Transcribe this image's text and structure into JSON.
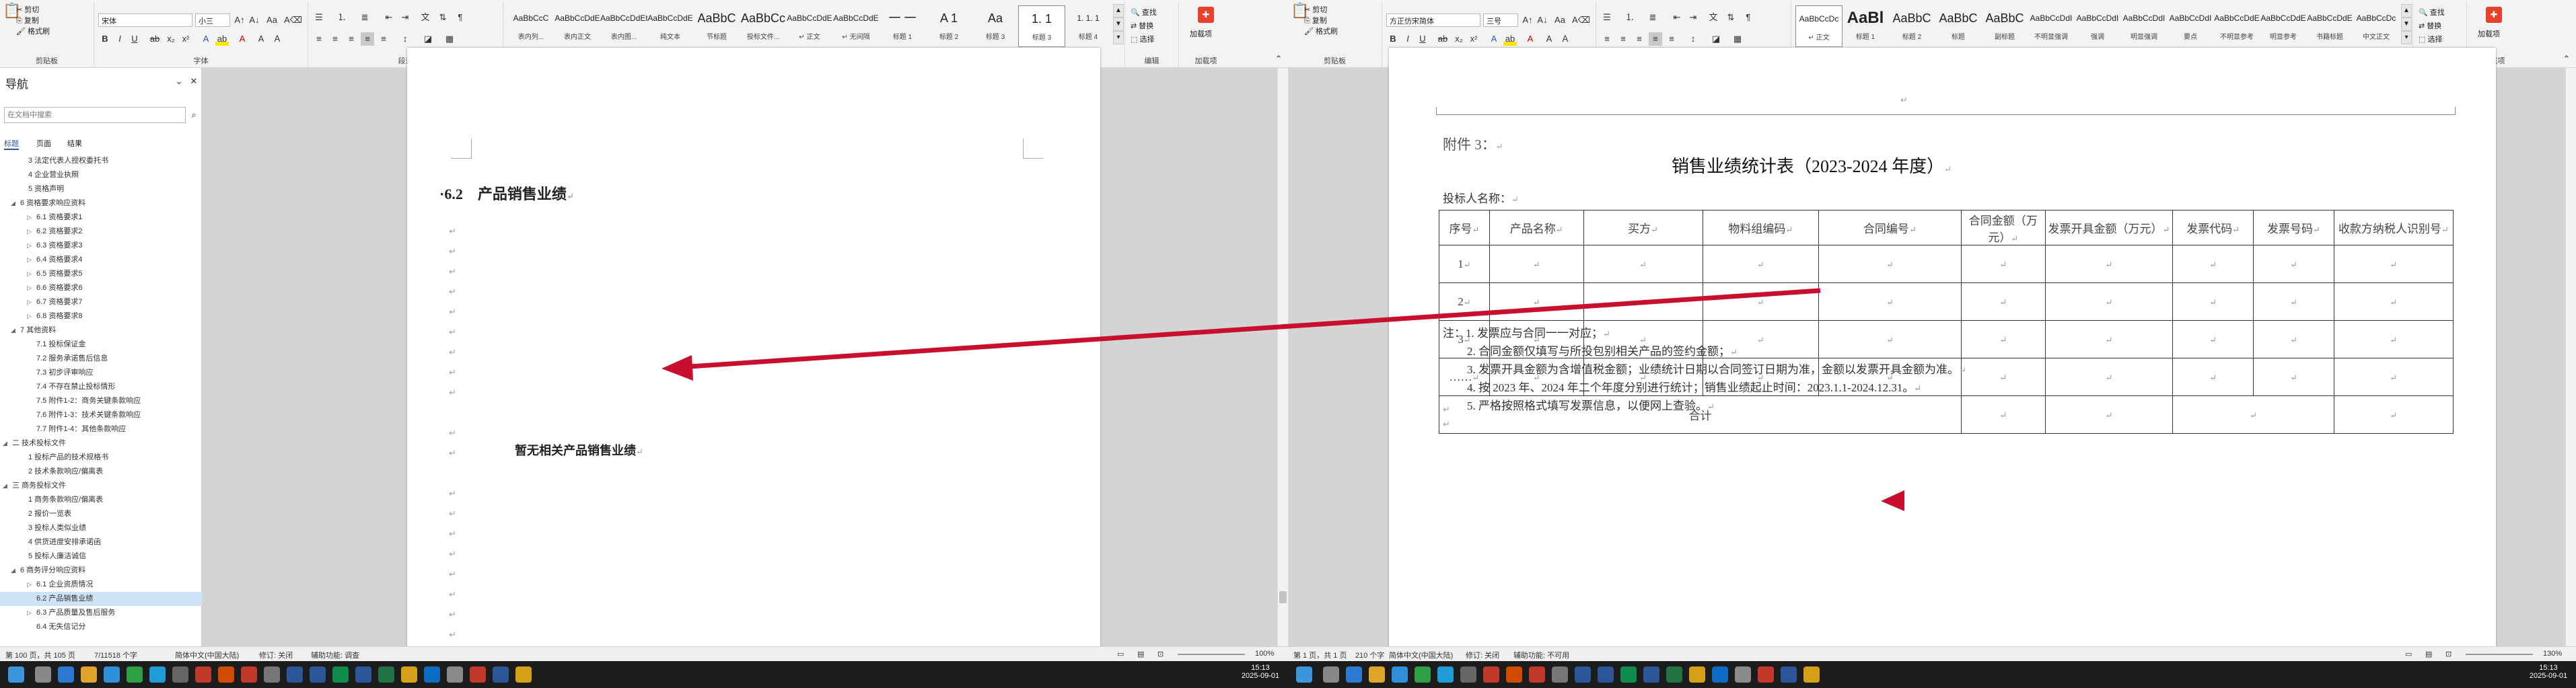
{
  "ribbon_left": {
    "clipboard": {
      "cut": "剪切",
      "copy": "复制",
      "painter": "格式刷",
      "label": "剪贴板"
    },
    "font": {
      "name": "宋体",
      "size": "小三",
      "label": "字体"
    },
    "paragraph": {
      "label": "段落"
    },
    "styles": {
      "label": "样式",
      "items": [
        {
          "preview": "AaBbCcC",
          "name": "表内列..."
        },
        {
          "preview": "AaBbCcDdE",
          "name": "表内正文"
        },
        {
          "preview": "AaBbCcDdEt",
          "name": "表内图..."
        },
        {
          "preview": "AaBbCcDdE",
          "name": "纯文本"
        },
        {
          "preview": "AaBbC",
          "name": "节标题"
        },
        {
          "preview": "AaBbCc",
          "name": "投标文件..."
        },
        {
          "preview": "AaBbCcDdE",
          "name": "↵ 正文"
        },
        {
          "preview": "AaBbCcDdE",
          "name": "↵ 无间隔"
        },
        {
          "preview": "一 一",
          "name": "标题 1"
        },
        {
          "preview": "A 1",
          "name": "标题 2"
        },
        {
          "preview": "Aa",
          "name": "标题 3"
        },
        {
          "preview": "1. 1",
          "name": "标题 3"
        },
        {
          "preview": "1. 1. 1",
          "name": "标题 4"
        }
      ]
    },
    "editing": {
      "find": "查找",
      "replace": "替换",
      "select": "选择",
      "label": "编辑"
    },
    "addin": {
      "name": "加载项",
      "label": "加载项"
    }
  },
  "ribbon_right": {
    "clipboard": {
      "cut": "剪切",
      "copy": "复制",
      "painter": "格式刷",
      "label": "剪贴板"
    },
    "font": {
      "name": "方正仿宋简体",
      "size": "三号",
      "label": "字体"
    },
    "paragraph": {
      "label": "段落"
    },
    "styles": {
      "label": "样式",
      "items": [
        {
          "preview": "AaBbCcDc",
          "name": "↵ 正文"
        },
        {
          "preview": "AaBl",
          "name": "标题 1"
        },
        {
          "preview": "AaBbC",
          "name": "标题 2"
        },
        {
          "preview": "AaBbC",
          "name": "标题"
        },
        {
          "preview": "AaBbC",
          "name": "副标题"
        },
        {
          "preview": "AaBbCcDdI",
          "name": "不明显强调"
        },
        {
          "preview": "AaBbCcDdI",
          "name": "强调"
        },
        {
          "preview": "AaBbCcDdI",
          "name": "明显强调"
        },
        {
          "preview": "AaBbCcDdI",
          "name": "要点"
        },
        {
          "preview": "AaBbCcDdE",
          "name": "不明显参考"
        },
        {
          "preview": "AaBbCcDdE",
          "name": "明显参考"
        },
        {
          "preview": "AaBbCcDdE",
          "name": "书籍标题"
        },
        {
          "preview": "AaBbCcDc",
          "name": "中文正文"
        }
      ]
    },
    "editing": {
      "find": "查找",
      "replace": "替换",
      "select": "选择",
      "label": "编辑"
    },
    "addin": {
      "name": "加载项",
      "label": "加载项"
    }
  },
  "nav": {
    "title": "导航",
    "search_placeholder": "在文档中搜索",
    "tabs": [
      "标题",
      "页面",
      "结果"
    ],
    "items": [
      {
        "text": "3 法定代表人授权委托书",
        "level": 2,
        "toggle": ""
      },
      {
        "text": "4 企业营业执照",
        "level": 2,
        "toggle": ""
      },
      {
        "text": "5 资格声明",
        "level": 2,
        "toggle": ""
      },
      {
        "text": "6 资格要求响应资料",
        "level": 1,
        "toggle": "◢"
      },
      {
        "text": "6.1 资格要求1",
        "level": 3,
        "toggle": "▷"
      },
      {
        "text": "6.2 资格要求2",
        "level": 3,
        "toggle": "▷"
      },
      {
        "text": "6.3 资格要求3",
        "level": 3,
        "toggle": "▷"
      },
      {
        "text": "6.4 资格要求4",
        "level": 3,
        "toggle": "▷"
      },
      {
        "text": "6.5 资格要求5",
        "level": 3,
        "toggle": "▷"
      },
      {
        "text": "6.6 资格要求6",
        "level": 3,
        "toggle": "▷"
      },
      {
        "text": "6.7 资格要求7",
        "level": 3,
        "toggle": "▷"
      },
      {
        "text": "6.8 资格要求8",
        "level": 3,
        "toggle": "▷"
      },
      {
        "text": "7 其他资料",
        "level": 1,
        "toggle": "◢"
      },
      {
        "text": "7.1 投标保证金",
        "level": 3,
        "toggle": ""
      },
      {
        "text": "7.2 服务承诺售后信息",
        "level": 3,
        "toggle": ""
      },
      {
        "text": "7.3 初步评审响应",
        "level": 3,
        "toggle": ""
      },
      {
        "text": "7.4 不存在禁止投标情形",
        "level": 3,
        "toggle": ""
      },
      {
        "text": "7.5 附件1-2：商务关键条款响应",
        "level": 3,
        "toggle": ""
      },
      {
        "text": "7.6 附件1-3：技术关键条款响应",
        "level": 3,
        "toggle": ""
      },
      {
        "text": "7.7 附件1-4：其他条款响应",
        "level": 3,
        "toggle": ""
      },
      {
        "text": "二 技术投标文件",
        "level": 0,
        "toggle": "◢"
      },
      {
        "text": "1 投标产品的技术规格书",
        "level": 2,
        "toggle": ""
      },
      {
        "text": "2 技术条款响应/偏离表",
        "level": 2,
        "toggle": ""
      },
      {
        "text": "三 商务投标文件",
        "level": 0,
        "toggle": "◢"
      },
      {
        "text": "1 商务条款响应/偏离表",
        "level": 2,
        "toggle": ""
      },
      {
        "text": "2 报价一览表",
        "level": 2,
        "toggle": ""
      },
      {
        "text": "3 投标人类似业绩",
        "level": 2,
        "toggle": ""
      },
      {
        "text": "4 供货进度安排承诺函",
        "level": 2,
        "toggle": ""
      },
      {
        "text": "5 投标人廉洁诚信",
        "level": 2,
        "toggle": ""
      },
      {
        "text": "6 商务评分响应资料",
        "level": 1,
        "toggle": "◢"
      },
      {
        "text": "6.1 企业资质情况",
        "level": 3,
        "toggle": "▷"
      },
      {
        "text": "6.2 产品销售业绩",
        "level": 3,
        "toggle": "",
        "selected": true
      },
      {
        "text": "6.3 产品质量及售后服务",
        "level": 3,
        "toggle": "▷"
      },
      {
        "text": "6.4 无失信记分",
        "level": 3,
        "toggle": ""
      }
    ]
  },
  "left_doc": {
    "heading": "6.2　产品销售业绩",
    "body": "暂无相关产品销售业绩",
    "para_mark": "↵"
  },
  "right_doc": {
    "attachment": "附件 3：",
    "title": "销售业绩统计表（2023-2024 年度）",
    "bidder": "投标人名称：",
    "table": {
      "headers": [
        "序号",
        "产品名称",
        "买方",
        "物料组编码",
        "合同编号",
        "合同金额（万元）",
        "发票开具金额（万元）",
        "发票代码",
        "发票号码",
        "收款方纳税人识别号"
      ],
      "rows": [
        "1",
        "2",
        "3",
        "……"
      ],
      "total": "合计"
    },
    "notes": [
      "注：1. 发票应与合同一一对应；",
      "2. 合同金额仅填写与所投包别相关产品的签约金额；",
      "3. 发票开具金额为含增值税金额；业绩统计日期以合同签订日期为准，金额以发票开具金额为准。",
      "4. 按 2023 年、2024 年二个年度分别进行统计；销售业绩起止时间：2023.1.1-2024.12.31。",
      "5. 严格按照格式填写发票信息，以便网上查验。"
    ]
  },
  "status_left": {
    "page": "第 100 页，共 105 页",
    "words": "7/11518 个字",
    "lang": "简体中文(中国大陆)",
    "track": "修订: 关闭",
    "access": "辅助功能: 调查",
    "zoom": "100%"
  },
  "status_right": {
    "page": "第 1 页，共 1 页",
    "words": "210 个字",
    "lang": "简体中文(中国大陆)",
    "track": "修订: 关闭",
    "access": "辅助功能: 不可用",
    "zoom": "130%"
  },
  "clock_left": {
    "time": "15:13",
    "date": "2025-09-01"
  },
  "clock_right": {
    "time": "15:13",
    "date": "2025-09-01"
  },
  "colors": {
    "arrow": "#c8102e",
    "accent": "#2b579a",
    "taskbar": "#1c1c1c"
  }
}
